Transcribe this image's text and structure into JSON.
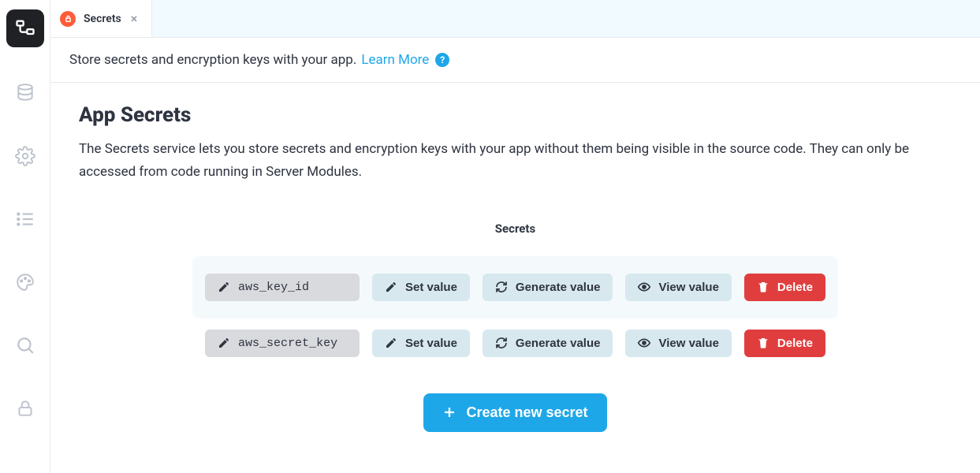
{
  "tab": {
    "label": "Secrets"
  },
  "intro": {
    "text": "Store secrets and encryption keys with your app.",
    "learn_more": "Learn More"
  },
  "page": {
    "title": "App Secrets",
    "description": "The Secrets service lets you store secrets and encryption keys with your app without them being visible in the source code. They can only be accessed from code running in Server Modules."
  },
  "secrets": {
    "heading": "Secrets",
    "rows": [
      {
        "name": "aws_key_id"
      },
      {
        "name": "aws_secret_key"
      }
    ],
    "actions": {
      "set_value": "Set value",
      "generate_value": "Generate value",
      "view_value": "View value",
      "delete": "Delete"
    },
    "create_label": "Create new secret"
  }
}
